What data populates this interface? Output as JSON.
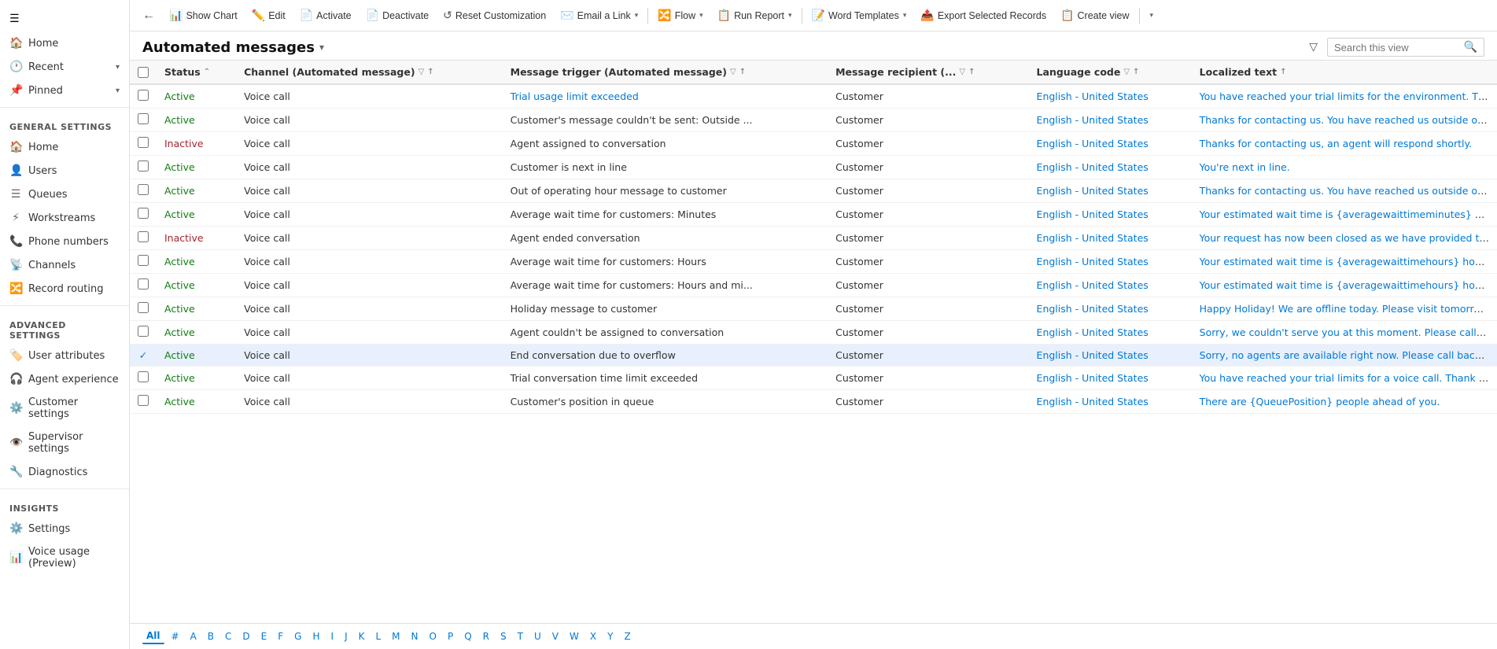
{
  "sidebar": {
    "hamburger": "☰",
    "general_settings_title": "General settings",
    "advanced_settings_title": "Advanced settings",
    "insights_title": "Insights",
    "items": [
      {
        "id": "home",
        "label": "Home",
        "icon": "🏠",
        "hasArrow": false
      },
      {
        "id": "recent",
        "label": "Recent",
        "icon": "🕐",
        "hasArrow": true
      },
      {
        "id": "pinned",
        "label": "Pinned",
        "icon": "📌",
        "hasArrow": true
      },
      {
        "id": "home2",
        "label": "Home",
        "icon": "🏠",
        "hasArrow": false
      },
      {
        "id": "users",
        "label": "Users",
        "icon": "👤",
        "hasArrow": false
      },
      {
        "id": "queues",
        "label": "Queues",
        "icon": "☰",
        "hasArrow": false
      },
      {
        "id": "workstreams",
        "label": "Workstreams",
        "icon": "⚡",
        "hasArrow": false
      },
      {
        "id": "phone-numbers",
        "label": "Phone numbers",
        "icon": "📞",
        "hasArrow": false
      },
      {
        "id": "channels",
        "label": "Channels",
        "icon": "📡",
        "hasArrow": false
      },
      {
        "id": "record-routing",
        "label": "Record routing",
        "icon": "🔀",
        "hasArrow": false
      },
      {
        "id": "user-attributes",
        "label": "User attributes",
        "icon": "🏷️",
        "hasArrow": false
      },
      {
        "id": "agent-experience",
        "label": "Agent experience",
        "icon": "🎧",
        "hasArrow": false
      },
      {
        "id": "customer-settings",
        "label": "Customer settings",
        "icon": "⚙️",
        "hasArrow": false
      },
      {
        "id": "supervisor-settings",
        "label": "Supervisor settings",
        "icon": "👁️",
        "hasArrow": false
      },
      {
        "id": "diagnostics",
        "label": "Diagnostics",
        "icon": "🔧",
        "hasArrow": false
      },
      {
        "id": "settings",
        "label": "Settings",
        "icon": "⚙️",
        "hasArrow": false
      },
      {
        "id": "voice-usage",
        "label": "Voice usage (Preview)",
        "icon": "📊",
        "hasArrow": false
      }
    ]
  },
  "toolbar": {
    "back_icon": "←",
    "show_chart_label": "Show Chart",
    "show_chart_icon": "📊",
    "edit_label": "Edit",
    "edit_icon": "✏️",
    "activate_label": "Activate",
    "activate_icon": "📄",
    "deactivate_label": "Deactivate",
    "deactivate_icon": "📄",
    "reset_label": "Reset Customization",
    "reset_icon": "↺",
    "email_link_label": "Email a Link",
    "email_link_icon": "✉️",
    "flow_label": "Flow",
    "flow_icon": "🔀",
    "run_report_label": "Run Report",
    "run_report_icon": "📋",
    "word_templates_label": "Word Templates",
    "word_templates_icon": "📝",
    "export_label": "Export Selected Records",
    "export_icon": "📤",
    "create_view_label": "Create view",
    "create_view_icon": "📋",
    "more_icon": "▾"
  },
  "page": {
    "title": "Automated messages",
    "title_arrow": "▾",
    "filter_icon": "▽",
    "search_placeholder": "Search this view",
    "search_icon": "🔍"
  },
  "table": {
    "columns": [
      {
        "id": "status",
        "label": "Status",
        "sortable": true,
        "filterable": false
      },
      {
        "id": "channel",
        "label": "Channel (Automated message)",
        "sortable": false,
        "filterable": true
      },
      {
        "id": "trigger",
        "label": "Message trigger (Automated message)",
        "sortable": false,
        "filterable": false,
        "sortable2": true
      },
      {
        "id": "recipient",
        "label": "Message recipient (...",
        "sortable": false,
        "filterable": true
      },
      {
        "id": "language",
        "label": "Language code",
        "sortable": false,
        "filterable": true
      },
      {
        "id": "localized_text",
        "label": "Localized text",
        "sortable": false,
        "filterable": false,
        "sortable2": true
      }
    ],
    "rows": [
      {
        "id": 1,
        "status": "Active",
        "status_type": "active",
        "channel": "Voice call",
        "trigger": "Trial usage limit exceeded",
        "trigger_link": true,
        "recipient": "Customer",
        "language": "English - United States",
        "localized_text": "You have reached your trial limits for the environment. Thank you fo",
        "selected": false
      },
      {
        "id": 2,
        "status": "Active",
        "status_type": "active",
        "channel": "Voice call",
        "trigger": "Customer's message couldn't be sent: Outside ...",
        "trigger_link": false,
        "recipient": "Customer",
        "language": "English - United States",
        "localized_text": "Thanks for contacting us. You have reached us outside of our operatin",
        "selected": false
      },
      {
        "id": 3,
        "status": "Inactive",
        "status_type": "inactive",
        "channel": "Voice call",
        "trigger": "Agent assigned to conversation",
        "trigger_link": false,
        "recipient": "Customer",
        "language": "English - United States",
        "localized_text": "Thanks for contacting us, an agent will respond shortly.",
        "selected": false
      },
      {
        "id": 4,
        "status": "Active",
        "status_type": "active",
        "channel": "Voice call",
        "trigger": "Customer is next in line",
        "trigger_link": false,
        "recipient": "Customer",
        "language": "English - United States",
        "localized_text": "You're next in line.",
        "selected": false
      },
      {
        "id": 5,
        "status": "Active",
        "status_type": "active",
        "channel": "Voice call",
        "trigger": "Out of operating hour message to customer",
        "trigger_link": false,
        "recipient": "Customer",
        "language": "English - United States",
        "localized_text": "Thanks for contacting us. You have reached us outside of our operatin",
        "selected": false
      },
      {
        "id": 6,
        "status": "Active",
        "status_type": "active",
        "channel": "Voice call",
        "trigger": "Average wait time for customers: Minutes",
        "trigger_link": false,
        "recipient": "Customer",
        "language": "English - United States",
        "localized_text": "Your estimated wait time is {averagewaittimeminutes} minutes.",
        "selected": false
      },
      {
        "id": 7,
        "status": "Inactive",
        "status_type": "inactive",
        "channel": "Voice call",
        "trigger": "Agent ended conversation",
        "trigger_link": false,
        "recipient": "Customer",
        "language": "English - United States",
        "localized_text": "Your request has now been closed as we have provided the required i",
        "selected": false
      },
      {
        "id": 8,
        "status": "Active",
        "status_type": "active",
        "channel": "Voice call",
        "trigger": "Average wait time for customers: Hours",
        "trigger_link": false,
        "recipient": "Customer",
        "language": "English - United States",
        "localized_text": "Your estimated wait time is {averagewaittimehours} hours.",
        "selected": false
      },
      {
        "id": 9,
        "status": "Active",
        "status_type": "active",
        "channel": "Voice call",
        "trigger": "Average wait time for customers: Hours and mi...",
        "trigger_link": false,
        "recipient": "Customer",
        "language": "English - United States",
        "localized_text": "Your estimated wait time is {averagewaittimehours} hours and {averag",
        "selected": false
      },
      {
        "id": 10,
        "status": "Active",
        "status_type": "active",
        "channel": "Voice call",
        "trigger": "Holiday message to customer",
        "trigger_link": false,
        "recipient": "Customer",
        "language": "English - United States",
        "localized_text": "Happy Holiday! We are offline today. Please visit tomorrow.",
        "selected": false
      },
      {
        "id": 11,
        "status": "Active",
        "status_type": "active",
        "channel": "Voice call",
        "trigger": "Agent couldn't be assigned to conversation",
        "trigger_link": false,
        "recipient": "Customer",
        "language": "English - United States",
        "localized_text": "Sorry, we couldn't serve you at this moment. Please call back later.",
        "selected": false
      },
      {
        "id": 12,
        "status": "Active",
        "status_type": "active",
        "channel": "Voice call",
        "trigger": "End conversation due to overflow",
        "trigger_link": false,
        "recipient": "Customer",
        "language": "English - United States",
        "localized_text": "Sorry, no agents are available right now. Please call back later.",
        "selected": true
      },
      {
        "id": 13,
        "status": "Active",
        "status_type": "active",
        "channel": "Voice call",
        "trigger": "Trial conversation time limit exceeded",
        "trigger_link": false,
        "recipient": "Customer",
        "language": "English - United States",
        "localized_text": "You have reached your trial limits for a voice call. Thank you for trying",
        "selected": false
      },
      {
        "id": 14,
        "status": "Active",
        "status_type": "active",
        "channel": "Voice call",
        "trigger": "Customer's position in queue",
        "trigger_link": false,
        "recipient": "Customer",
        "language": "English - United States",
        "localized_text": "There are {QueuePosition} people ahead of you.",
        "selected": false
      }
    ]
  },
  "alphabet": {
    "items": [
      "All",
      "#",
      "A",
      "B",
      "C",
      "D",
      "E",
      "F",
      "G",
      "H",
      "I",
      "J",
      "K",
      "L",
      "M",
      "N",
      "O",
      "P",
      "Q",
      "R",
      "S",
      "T",
      "U",
      "V",
      "W",
      "X",
      "Y",
      "Z"
    ],
    "active": "All"
  }
}
